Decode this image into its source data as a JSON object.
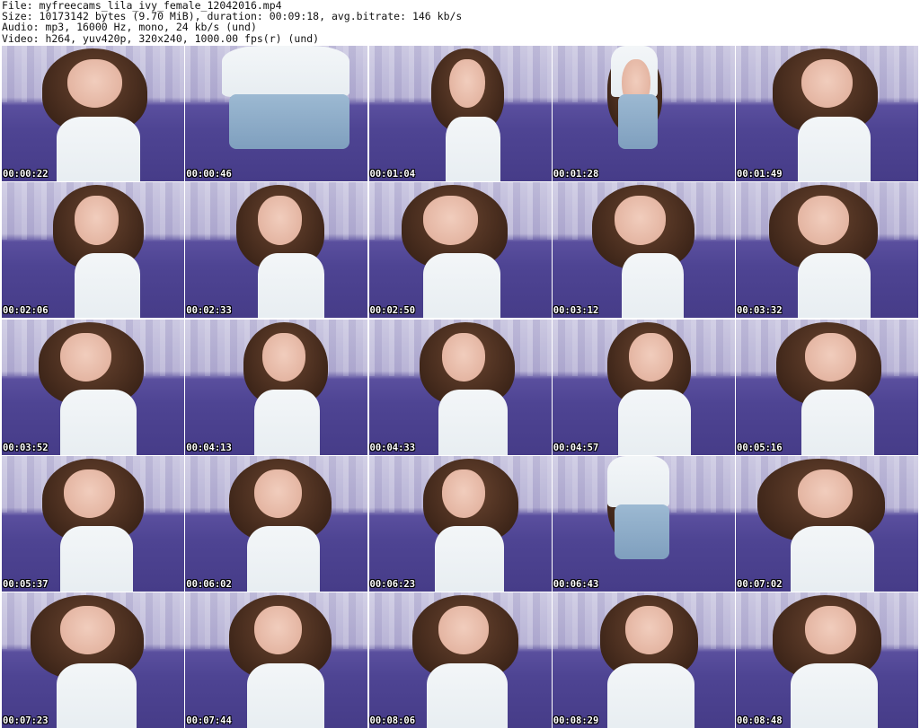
{
  "header": {
    "file_line": "File: myfreecams_lila_ivy_female_12042016.mp4",
    "size_line": "Size: 10173142 bytes (9.70 MiB), duration: 00:09:18, avg.bitrate: 146 kb/s",
    "audio_line": "Audio: mp3, 16000 Hz, mono, 24 kb/s (und)",
    "video_line": "Video: h264, yuv420p, 320x240, 1000.00 fps(r) (und)"
  },
  "thumbnails": [
    {
      "timestamp": "00:00:22"
    },
    {
      "timestamp": "00:00:46"
    },
    {
      "timestamp": "00:01:04"
    },
    {
      "timestamp": "00:01:28"
    },
    {
      "timestamp": "00:01:49"
    },
    {
      "timestamp": "00:02:06"
    },
    {
      "timestamp": "00:02:33"
    },
    {
      "timestamp": "00:02:50"
    },
    {
      "timestamp": "00:03:12"
    },
    {
      "timestamp": "00:03:32"
    },
    {
      "timestamp": "00:03:52"
    },
    {
      "timestamp": "00:04:13"
    },
    {
      "timestamp": "00:04:33"
    },
    {
      "timestamp": "00:04:57"
    },
    {
      "timestamp": "00:05:16"
    },
    {
      "timestamp": "00:05:37"
    },
    {
      "timestamp": "00:06:02"
    },
    {
      "timestamp": "00:06:23"
    },
    {
      "timestamp": "00:06:43"
    },
    {
      "timestamp": "00:07:02"
    },
    {
      "timestamp": "00:07:23"
    },
    {
      "timestamp": "00:07:44"
    },
    {
      "timestamp": "00:08:06"
    },
    {
      "timestamp": "00:08:29"
    },
    {
      "timestamp": "00:08:48"
    }
  ]
}
